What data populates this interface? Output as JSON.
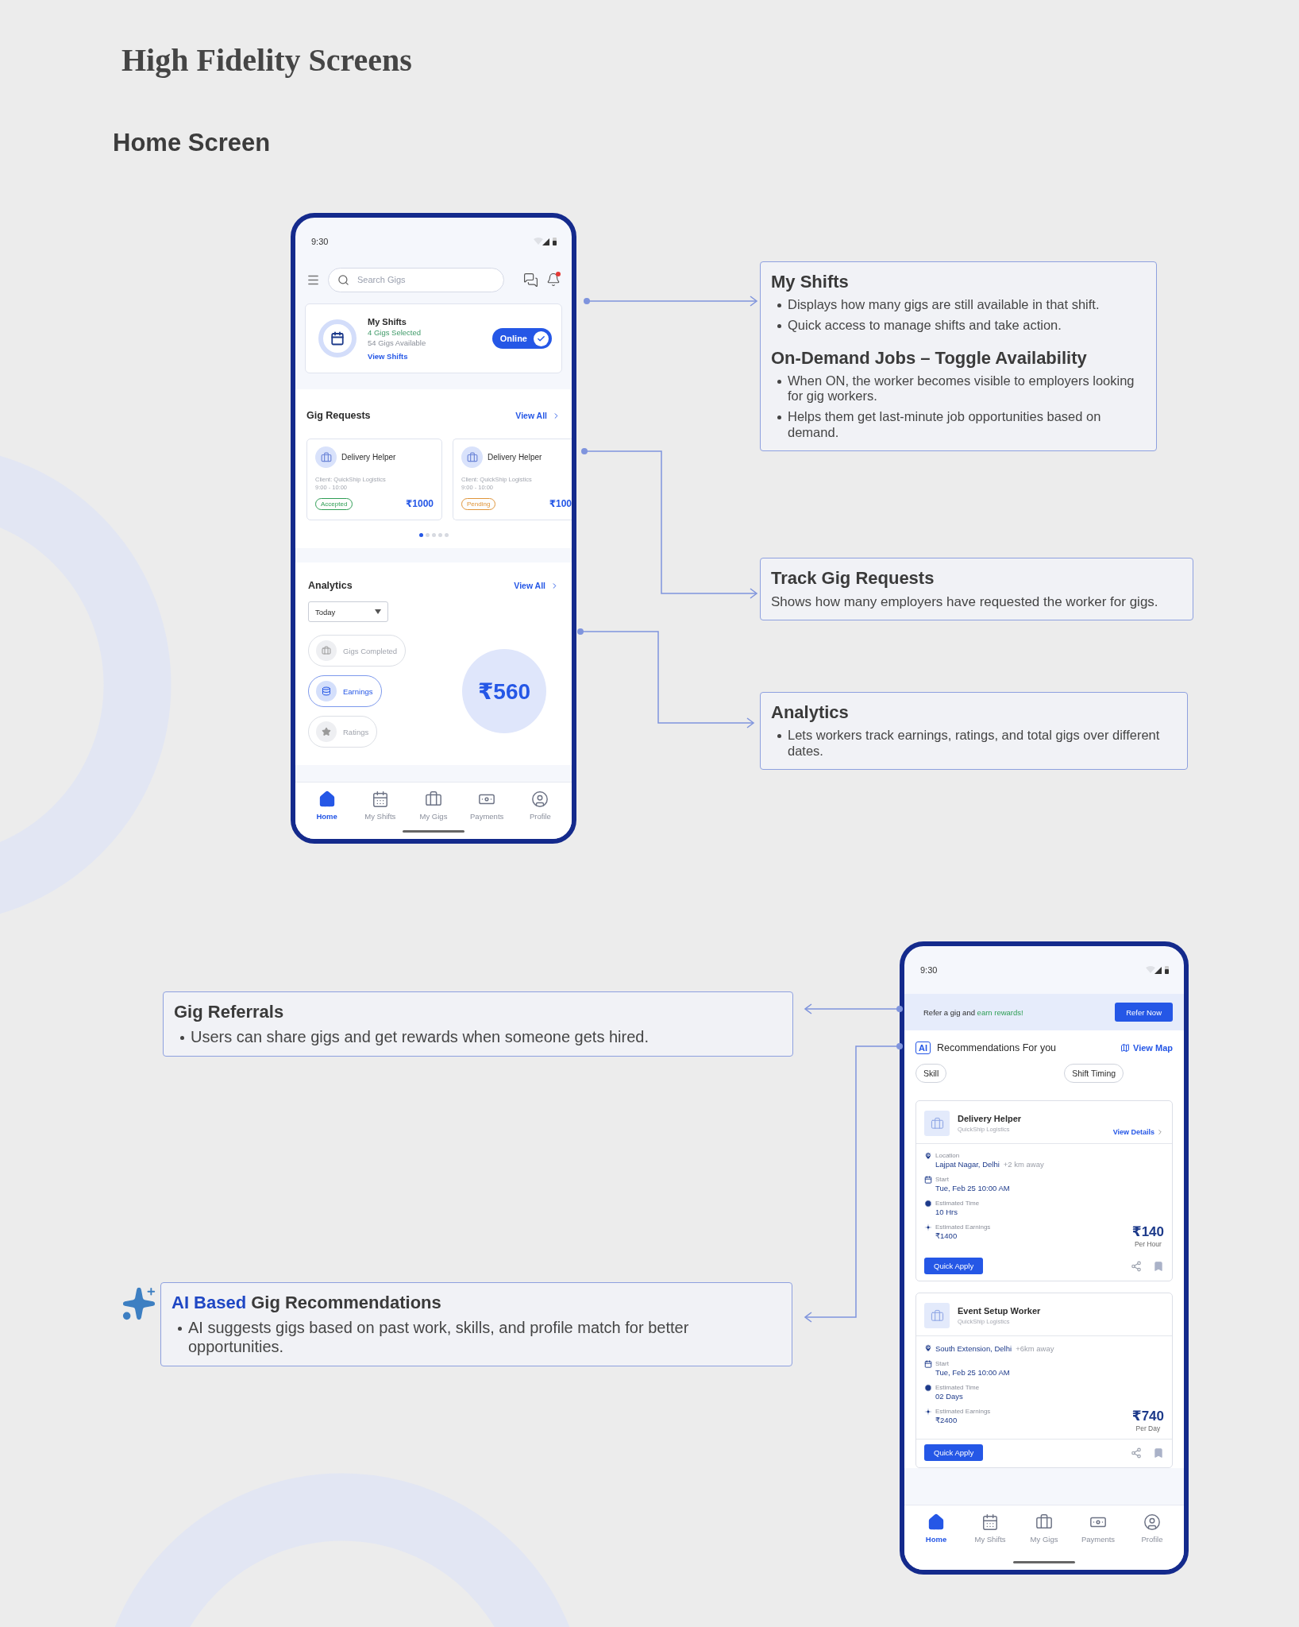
{
  "page": {
    "title": "High Fidelity Screens",
    "section": "Home Screen"
  },
  "home_phone": {
    "status_time": "9:30",
    "search": {
      "placeholder": "Search Gigs"
    },
    "notifications": {
      "unread": true
    },
    "shifts": {
      "title": "My Shifts",
      "selected_count": "4 Gigs Selected",
      "available": "54 Gigs Available",
      "link": "View Shifts",
      "toggle": {
        "label": "Online",
        "on": true
      }
    },
    "gig_requests": {
      "title": "Gig Requests",
      "view_all": "View All",
      "cards": [
        {
          "title": "Delivery Helper",
          "client": "Client: QuickShip Logistics",
          "time": "9:00 - 10:00",
          "status": "Accepted",
          "color": "#2f9e55",
          "price": "₹1000"
        },
        {
          "title": "Delivery Helper",
          "client": "Client: QuickShip Logistics",
          "time": "9:00 - 10:00",
          "status": "Pending",
          "color": "#e0953a",
          "price": "₹100"
        }
      ],
      "pager": [
        {
          "selected": true
        },
        {
          "selected": false
        },
        {
          "selected": false
        },
        {
          "selected": false
        },
        {
          "selected": false
        }
      ]
    },
    "analytics": {
      "title": "Analytics",
      "view_all": "View All",
      "period": "Today",
      "metrics": [
        {
          "label": "Gigs Completed",
          "selected": false
        },
        {
          "label": "Earnings",
          "selected": true
        },
        {
          "label": "Ratings",
          "selected": false
        }
      ],
      "value": "₹560"
    },
    "nav": [
      {
        "label": "Home",
        "selected": true
      },
      {
        "label": "My Shifts",
        "selected": false
      },
      {
        "label": "My Gigs",
        "selected": false
      },
      {
        "label": "Payments",
        "selected": false
      },
      {
        "label": "Profile",
        "selected": false
      }
    ]
  },
  "home_callouts": [
    {
      "sections": [
        {
          "heading": "My Shifts",
          "bullets": [
            "Displays how many gigs are still available in that shift.",
            "Quick access to manage shifts and take action."
          ]
        },
        {
          "heading": "On-Demand Jobs – Toggle Availability",
          "bullets": [
            "When ON, the worker becomes visible to employers looking for gig workers.",
            "Helps them get last-minute job opportunities based on demand."
          ]
        }
      ]
    },
    {
      "sections": [
        {
          "heading": "Track Gig Requests",
          "text": "Shows how many employers have requested the worker for gigs."
        }
      ]
    },
    {
      "sections": [
        {
          "heading": "Analytics",
          "bullets": [
            "Lets workers track earnings, ratings, and total gigs over different dates."
          ]
        }
      ]
    }
  ],
  "recommend_callouts": [
    {
      "sections": [
        {
          "heading": "Gig Referrals",
          "bullets": [
            "Users can share gigs and get rewards when someone gets hired."
          ]
        }
      ]
    },
    {
      "sections": [
        {
          "heading_highlight": "AI Based",
          "heading": "Gig Recommendations",
          "bullets": [
            "AI suggests gigs based on past work, skills, and profile match for better opportunities."
          ]
        }
      ]
    }
  ],
  "recommend_phone": {
    "status_time": "9:30",
    "banner": {
      "text": "Refer a gig and",
      "highlight": "earn rewards!",
      "button": "Refer Now"
    },
    "ai_badge": "AI",
    "title": "Recommendations For you",
    "view_map": "View Map",
    "filters": [
      "Skill",
      "Shift Timing"
    ],
    "jobs": [
      {
        "title": "Delivery Helper",
        "company": "QuickShip Logistics",
        "view_details": "View Details",
        "location_label": "Location",
        "location": "Lajpat Nagar, Delhi",
        "distance": "+2 km away",
        "start_label": "Start",
        "start": "Tue, Feb 25 10:00 AM",
        "time_label": "Estimated Time",
        "time": "10 Hrs",
        "earnings_label": "Estimated Earnings",
        "earnings": "₹1400",
        "rate": "₹140",
        "rate_unit": "Per Hour",
        "apply": "Quick Apply"
      },
      {
        "title": "Event Setup Worker",
        "company": "QuickShip Logistics",
        "location": "South Extension, Delhi",
        "distance": "+6km away",
        "start_label": "Start",
        "start": "Tue, Feb 25 10:00 AM",
        "time_label": "Estimated Time",
        "time": "02 Days",
        "earnings_label": "Estimated Earnings",
        "earnings": "₹2400",
        "rate": "₹740",
        "rate_unit": "Per Day",
        "apply": "Quick Apply"
      }
    ],
    "nav": [
      {
        "label": "Home",
        "selected": true
      },
      {
        "label": "My Shifts",
        "selected": false
      },
      {
        "label": "My Gigs",
        "selected": false
      },
      {
        "label": "Payments",
        "selected": false
      },
      {
        "label": "Profile",
        "selected": false
      }
    ]
  }
}
